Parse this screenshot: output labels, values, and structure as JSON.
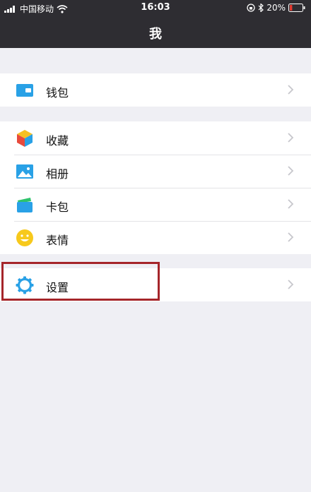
{
  "status_bar": {
    "carrier": "中国移动",
    "time": "16:03",
    "battery_percent": "20%",
    "battery_level": 0.2,
    "icons": [
      "signal-icon",
      "wifi-icon",
      "orientation-lock-icon",
      "bluetooth-icon",
      "battery-icon"
    ]
  },
  "header": {
    "title": "我"
  },
  "menu": {
    "wallet": {
      "label": "钱包",
      "icon": "wallet-icon"
    },
    "favorites": {
      "label": "收藏",
      "icon": "cube-icon"
    },
    "album": {
      "label": "相册",
      "icon": "photo-icon"
    },
    "cards": {
      "label": "卡包",
      "icon": "card-icon"
    },
    "stickers": {
      "label": "表情",
      "icon": "smiley-icon"
    },
    "settings": {
      "label": "设置",
      "icon": "gear-icon"
    }
  },
  "colors": {
    "header_bg": "#2e2d32",
    "page_bg": "#efeff4",
    "highlight_border": "#a5252a",
    "accent_blue": "#29a1e6"
  }
}
